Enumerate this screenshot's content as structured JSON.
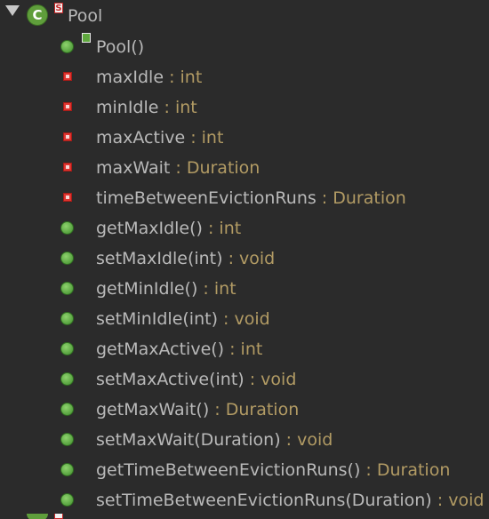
{
  "tree": {
    "class_row": {
      "icon_letter": "C",
      "static_badge": "S",
      "name": "Pool"
    },
    "members": [
      {
        "kind": "constructor",
        "name": "Pool()",
        "type": ""
      },
      {
        "kind": "field",
        "name": "maxIdle",
        "type": " : int"
      },
      {
        "kind": "field",
        "name": "minIdle",
        "type": " : int"
      },
      {
        "kind": "field",
        "name": "maxActive",
        "type": " : int"
      },
      {
        "kind": "field",
        "name": "maxWait",
        "type": " : Duration"
      },
      {
        "kind": "field",
        "name": "timeBetweenEvictionRuns",
        "type": " : Duration"
      },
      {
        "kind": "method",
        "name": "getMaxIdle()",
        "type": " : int"
      },
      {
        "kind": "method",
        "name": "setMaxIdle(int)",
        "type": " : void"
      },
      {
        "kind": "method",
        "name": "getMinIdle()",
        "type": " : int"
      },
      {
        "kind": "method",
        "name": "setMinIdle(int)",
        "type": " : void"
      },
      {
        "kind": "method",
        "name": "getMaxActive()",
        "type": " : int"
      },
      {
        "kind": "method",
        "name": "setMaxActive(int)",
        "type": " : void"
      },
      {
        "kind": "method",
        "name": "getMaxWait()",
        "type": " : Duration"
      },
      {
        "kind": "method",
        "name": "setMaxWait(Duration)",
        "type": " : void"
      },
      {
        "kind": "method",
        "name": "getTimeBetweenEvictionRuns()",
        "type": " : Duration"
      },
      {
        "kind": "method",
        "name": "setTimeBetweenEvictionRuns(Duration)",
        "type": " : void"
      }
    ]
  },
  "colors": {
    "background": "#2b2b2b",
    "name_text": "#b9b9b9",
    "type_text": "#b29b64",
    "method_icon": "#5f9e3b",
    "field_icon": "#e0342f"
  }
}
